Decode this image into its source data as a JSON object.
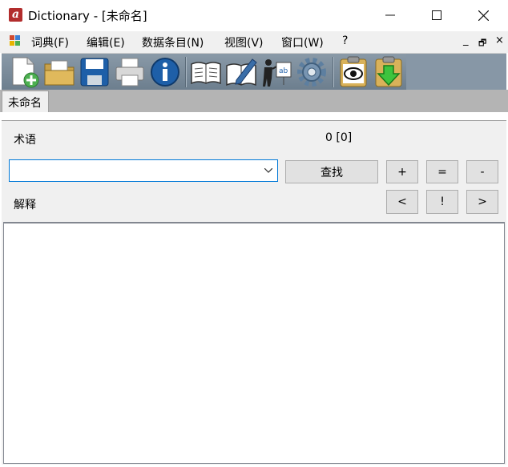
{
  "window": {
    "app_icon_glyph": "a",
    "title": "Dictionary - [未命名]",
    "minimize_glyph": "—",
    "maximize_glyph": "☐",
    "close_glyph": "✕"
  },
  "menu": {
    "items": [
      "词典(F)",
      "编辑(E)",
      "数据条目(N)",
      "视图(V)",
      "窗口(W)",
      "?"
    ],
    "mdi_minimize": "_",
    "mdi_restore": "🗗",
    "mdi_close": "×"
  },
  "toolbar": {
    "buttons": [
      "new-dictionary-icon",
      "open-folder-icon",
      "save-disk-icon",
      "print-icon",
      "info-icon",
      "open-book-icon",
      "edit-book-icon",
      "teacher-icon",
      "settings-gear-icon",
      "view-eye-icon",
      "import-down-arrow-icon"
    ]
  },
  "tabs": [
    {
      "label": "未命名"
    }
  ],
  "main": {
    "term_label": "术语",
    "count_text": "0 [0]",
    "search_value": "",
    "search_button": "查找",
    "add_button": "+",
    "equal_button": "=",
    "remove_button": "-",
    "explain_label": "解释",
    "prev_button": "<",
    "bang_button": "!",
    "next_button": ">"
  },
  "colors": {
    "accent": "#0078d7",
    "toolbar_bg": "#7a8b9a",
    "app_icon": "#b22d2d"
  }
}
